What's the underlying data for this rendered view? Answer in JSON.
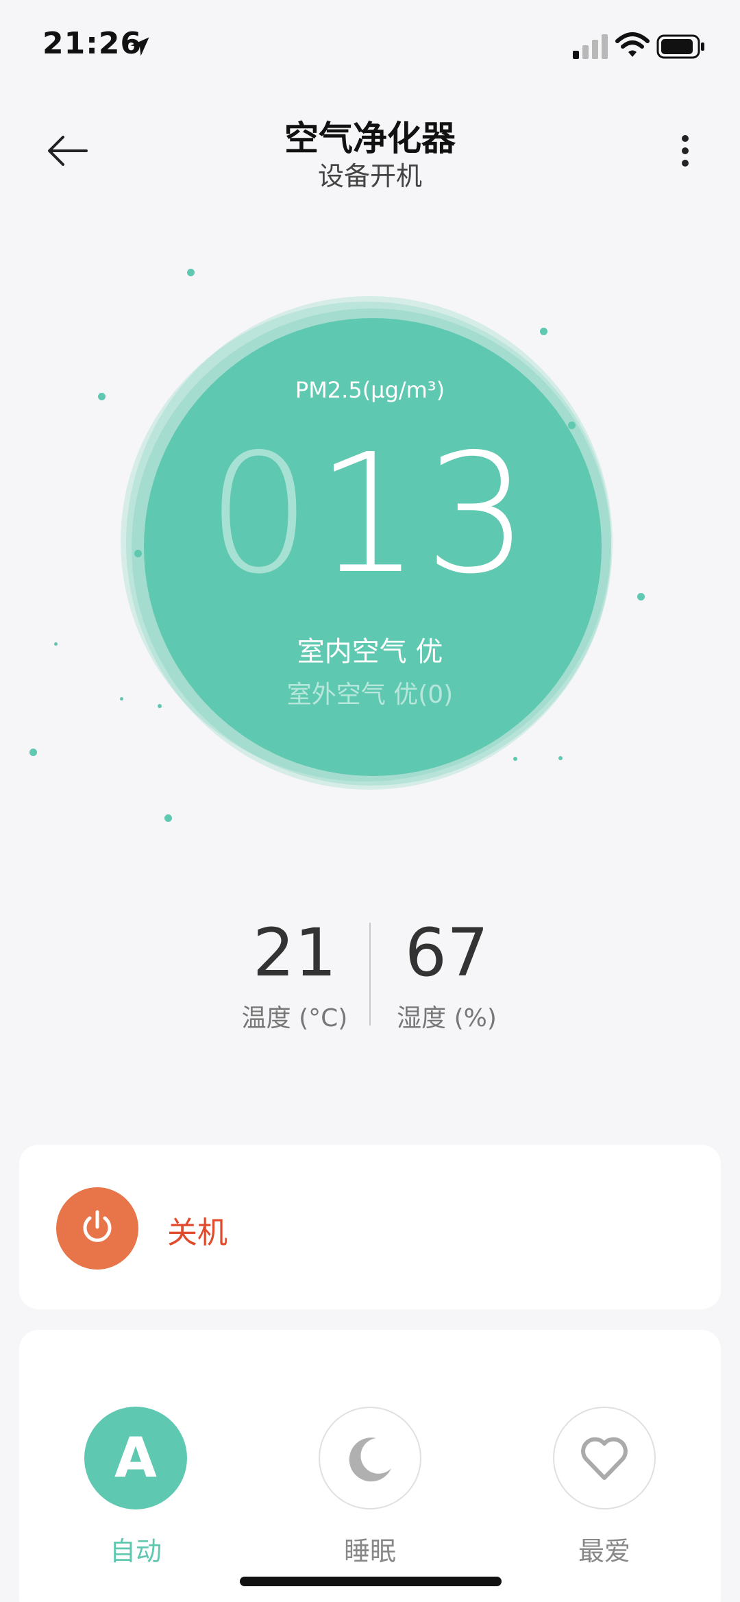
{
  "status_bar": {
    "time": "21:26"
  },
  "header": {
    "title": "空气净化器",
    "subtitle": "设备开机"
  },
  "air_quality": {
    "pm_label": "PM2.5(μg/m³)",
    "pm_value_leading": "0",
    "pm_value_main": "13",
    "indoor": "室内空气 优",
    "outdoor": "室外空气 优(0)",
    "color": "#5fc8b0"
  },
  "stats": {
    "temperature": {
      "value": "21",
      "label": "温度 (°C)"
    },
    "humidity": {
      "value": "67",
      "label": "湿度 (%)"
    }
  },
  "power": {
    "label": "关机",
    "icon": "power-icon",
    "color": "#e87549"
  },
  "modes": [
    {
      "label": "自动",
      "icon": "auto-icon",
      "symbol": "A",
      "active": true
    },
    {
      "label": "睡眠",
      "icon": "moon-icon",
      "active": false
    },
    {
      "label": "最爱",
      "icon": "heart-icon",
      "active": false
    }
  ]
}
